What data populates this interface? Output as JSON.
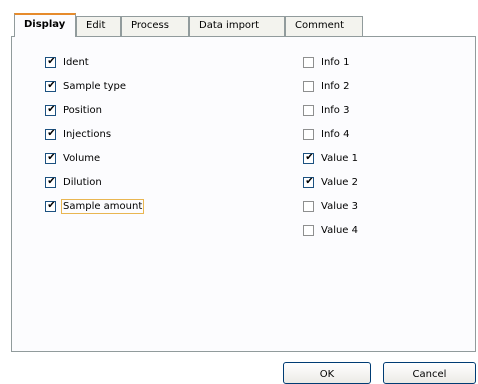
{
  "tabs": [
    {
      "label": "Display",
      "active": true
    },
    {
      "label": "Edit",
      "active": false
    },
    {
      "label": "Process",
      "active": false
    },
    {
      "label": "Data import",
      "active": false
    },
    {
      "label": "Comment",
      "active": false
    }
  ],
  "left_options": [
    {
      "label": "Ident",
      "checked": true
    },
    {
      "label": "Sample type",
      "checked": true
    },
    {
      "label": "Position",
      "checked": true
    },
    {
      "label": "Injections",
      "checked": true
    },
    {
      "label": "Volume",
      "checked": true
    },
    {
      "label": "Dilution",
      "checked": true
    },
    {
      "label": "Sample amount",
      "checked": true,
      "focused": true
    }
  ],
  "right_options": [
    {
      "label": "Info 1",
      "checked": false
    },
    {
      "label": "Info 2",
      "checked": false
    },
    {
      "label": "Info 3",
      "checked": false
    },
    {
      "label": "Info 4",
      "checked": false
    },
    {
      "label": "Value 1",
      "checked": true
    },
    {
      "label": "Value 2",
      "checked": true
    },
    {
      "label": "Value 3",
      "checked": false
    },
    {
      "label": "Value 4",
      "checked": false
    }
  ],
  "buttons": {
    "ok_label": "OK",
    "cancel_label": "Cancel"
  },
  "colors": {
    "tab_border": "#919b9c",
    "active_tab_accent": "#e68b2c",
    "checkbox_border": "#1c5180",
    "focus_outline": "#e9b651",
    "button_border": "#003c74"
  }
}
